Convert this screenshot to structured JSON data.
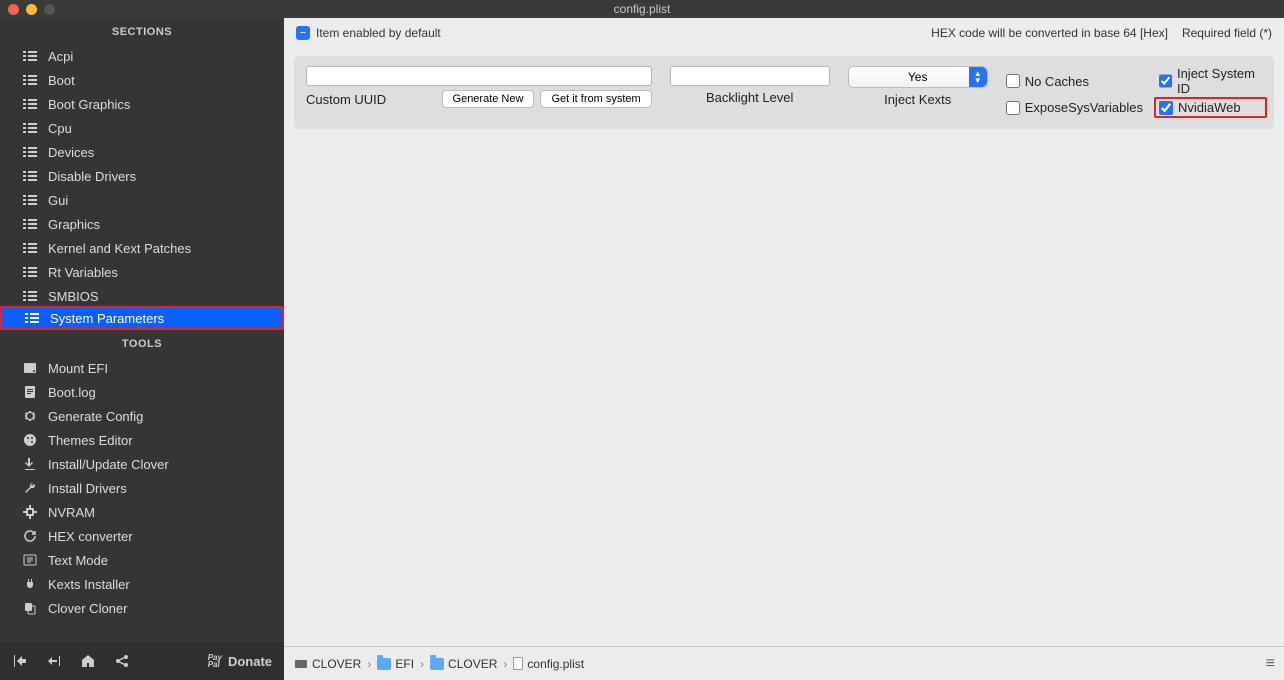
{
  "window": {
    "title": "config.plist"
  },
  "sidebar": {
    "sections_label": "SECTIONS",
    "tools_label": "TOOLS",
    "sections": [
      {
        "label": "Acpi",
        "icon": "list"
      },
      {
        "label": "Boot",
        "icon": "list"
      },
      {
        "label": "Boot Graphics",
        "icon": "list"
      },
      {
        "label": "Cpu",
        "icon": "list"
      },
      {
        "label": "Devices",
        "icon": "list"
      },
      {
        "label": "Disable Drivers",
        "icon": "list"
      },
      {
        "label": "Gui",
        "icon": "list"
      },
      {
        "label": "Graphics",
        "icon": "list"
      },
      {
        "label": "Kernel and Kext Patches",
        "icon": "list"
      },
      {
        "label": "Rt Variables",
        "icon": "list"
      },
      {
        "label": "SMBIOS",
        "icon": "list"
      },
      {
        "label": "System Parameters",
        "icon": "list",
        "selected": true
      }
    ],
    "tools": [
      {
        "label": "Mount EFI",
        "icon": "disk"
      },
      {
        "label": "Boot.log",
        "icon": "log"
      },
      {
        "label": "Generate Config",
        "icon": "gear"
      },
      {
        "label": "Themes Editor",
        "icon": "palette"
      },
      {
        "label": "Install/Update Clover",
        "icon": "download"
      },
      {
        "label": "Install Drivers",
        "icon": "wrench"
      },
      {
        "label": "NVRAM",
        "icon": "chip"
      },
      {
        "label": "HEX converter",
        "icon": "refresh"
      },
      {
        "label": "Text Mode",
        "icon": "text"
      },
      {
        "label": "Kexts Installer",
        "icon": "plug"
      },
      {
        "label": "Clover Cloner",
        "icon": "copy"
      }
    ],
    "footer": {
      "donate": "Donate"
    }
  },
  "info_bar": {
    "enabled_hint": "Item enabled by default",
    "hex_hint": "HEX code will be converted in base 64 [Hex]",
    "required_hint": "Required field (*)"
  },
  "form": {
    "custom_uuid": {
      "label": "Custom UUID",
      "value": "",
      "gen_btn": "Generate New",
      "get_btn": "Get it from system"
    },
    "backlight": {
      "label": "Backlight Level",
      "value": ""
    },
    "inject_kexts": {
      "label": "Inject Kexts",
      "selected": "Yes"
    },
    "no_caches": {
      "label": "No Caches",
      "checked": false
    },
    "inject_system_id": {
      "label": "Inject System ID",
      "checked": true
    },
    "expose_sys_vars": {
      "label": "ExposeSysVariables",
      "checked": false
    },
    "nvidia_web": {
      "label": "NvidiaWeb",
      "checked": true
    }
  },
  "breadcrumb": {
    "items": [
      {
        "label": "CLOVER",
        "type": "disk"
      },
      {
        "label": "EFI",
        "type": "folder"
      },
      {
        "label": "CLOVER",
        "type": "folder"
      },
      {
        "label": "config.plist",
        "type": "doc"
      }
    ]
  }
}
